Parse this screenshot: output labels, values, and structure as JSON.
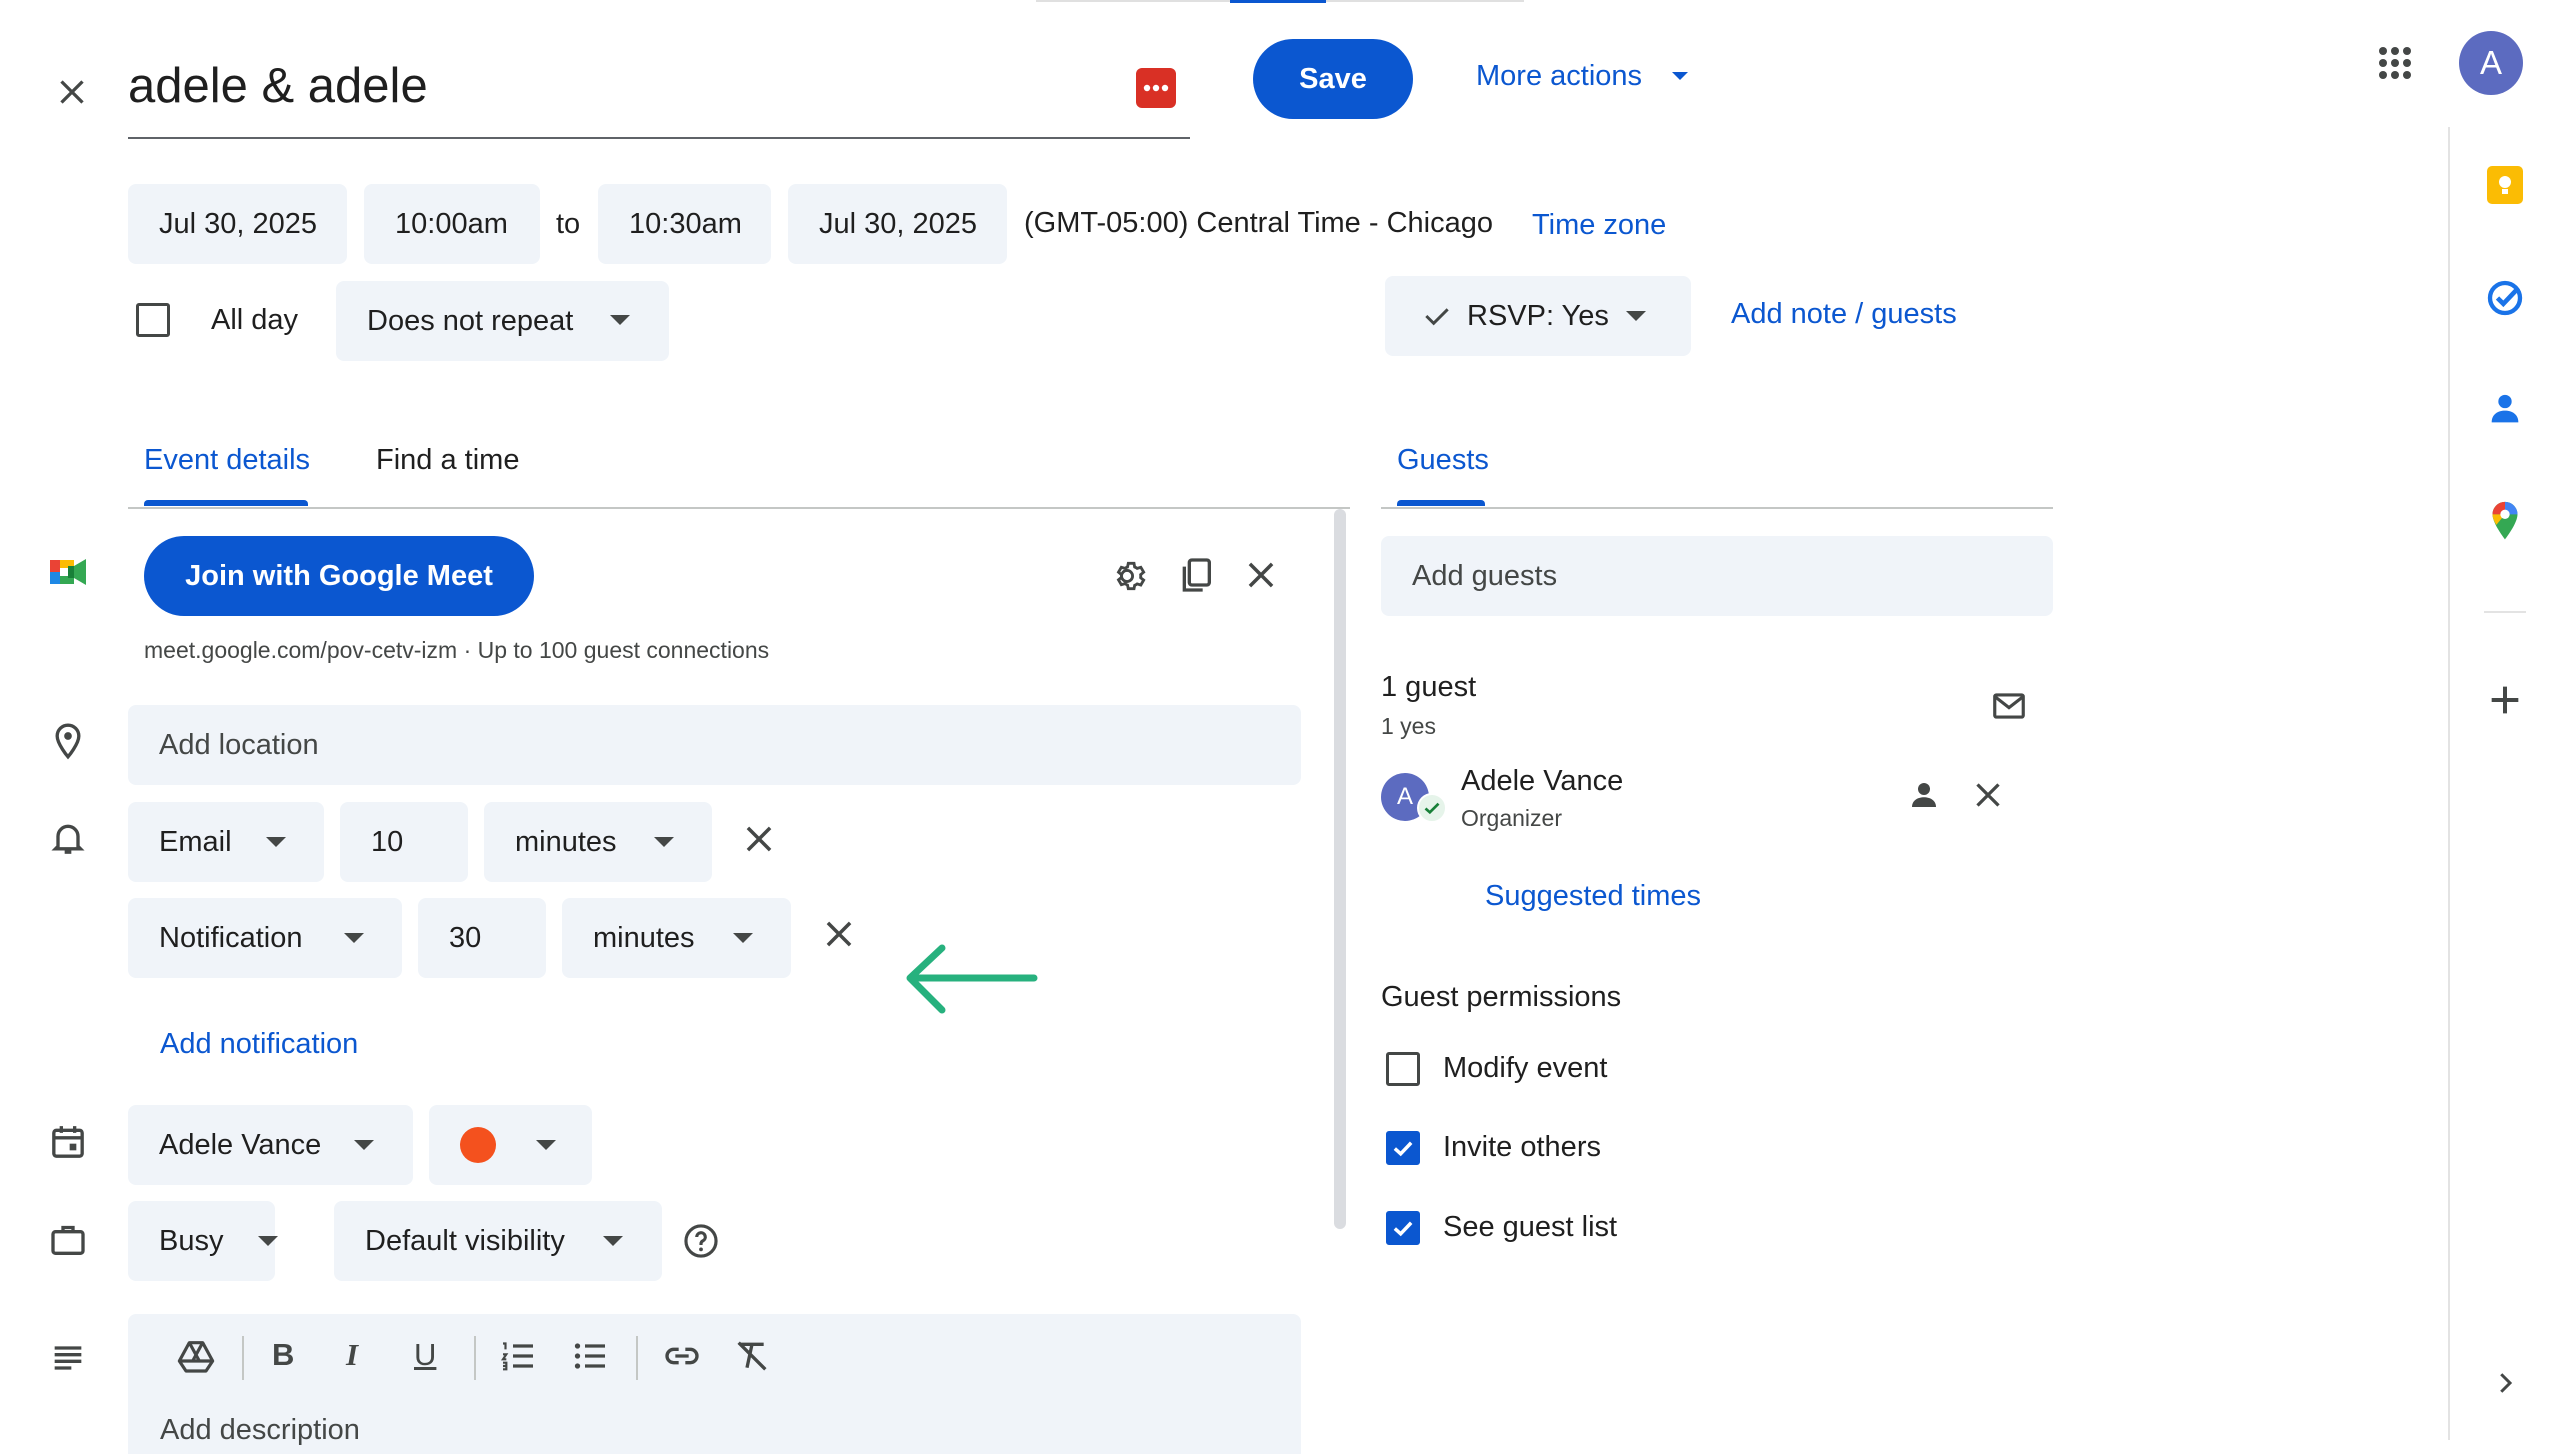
{
  "header": {
    "title": "adele & adele",
    "save_label": "Save",
    "more_actions_label": "More actions",
    "avatar_letter": "A"
  },
  "datetime": {
    "start_date": "Jul 30, 2025",
    "start_time": "10:00am",
    "to_label": "to",
    "end_time": "10:30am",
    "end_date": "Jul 30, 2025",
    "timezone_text": "(GMT-05:00) Central Time - Chicago",
    "timezone_link": "Time zone"
  },
  "options": {
    "all_day_label": "All day",
    "repeat_value": "Does not repeat",
    "rsvp_label": "RSVP: Yes",
    "add_note_label": "Add note / guests"
  },
  "tabs": [
    {
      "label": "Event details",
      "active": true
    },
    {
      "label": "Find a time",
      "active": false
    }
  ],
  "meet": {
    "join_label": "Join with Google Meet",
    "info": "meet.google.com/pov-cetv-izm · Up to 100 guest connections"
  },
  "location": {
    "placeholder": "Add location"
  },
  "notifications": [
    {
      "method": "Email",
      "amount": "10",
      "unit": "minutes"
    },
    {
      "method": "Notification",
      "amount": "30",
      "unit": "minutes"
    }
  ],
  "add_notification_label": "Add notification",
  "calendar": {
    "owner": "Adele Vance",
    "color": "#f4511e"
  },
  "availability": {
    "status": "Busy",
    "visibility": "Default visibility"
  },
  "description": {
    "placeholder": "Add description"
  },
  "guests_panel": {
    "tab_label": "Guests",
    "add_guests_placeholder": "Add guests",
    "count_label": "1 guest",
    "yes_count": "1 yes",
    "guest": {
      "avatar_letter": "A",
      "name": "Adele Vance",
      "role": "Organizer"
    },
    "suggested_times_label": "Suggested times",
    "permissions_title": "Guest permissions",
    "permissions": [
      {
        "label": "Modify event",
        "checked": false
      },
      {
        "label": "Invite others",
        "checked": true
      },
      {
        "label": "See guest list",
        "checked": true
      }
    ]
  },
  "colors": {
    "accent": "#0b57d0",
    "field_bg": "#f0f4f9",
    "arrow": "#27b17e",
    "avatar_bg": "#5c6bc0"
  },
  "icons": [
    "close-icon",
    "menu-dots-icon",
    "apps-grid-icon",
    "keep-icon",
    "tasks-icon",
    "contacts-icon",
    "maps-icon",
    "plus-icon",
    "chevron-right-icon",
    "meet-icon",
    "gear-icon",
    "copy-icon",
    "location-pin-icon",
    "bell-icon",
    "calendar-icon",
    "briefcase-icon",
    "help-icon",
    "description-icon",
    "mail-icon",
    "person-icon"
  ]
}
